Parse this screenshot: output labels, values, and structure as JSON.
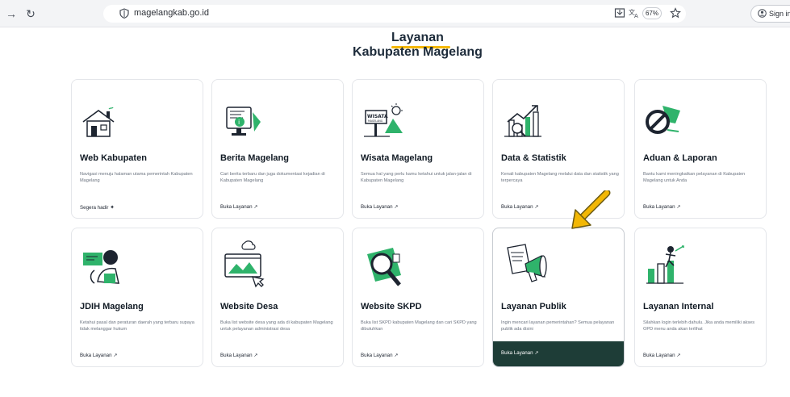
{
  "browser": {
    "url": "magelangkab.go.id",
    "zoom": "67%",
    "sign_in": "Sign in"
  },
  "page": {
    "title_line1": "Layanan",
    "title_line2": "Kabupaten Magelang"
  },
  "cards": [
    {
      "title": "Web Kabupaten",
      "desc": "Navigasi menuju halaman utama pemerintah Kabupaten Magelang",
      "link": "Segera hadir",
      "link_icon": "sparkle-icon"
    },
    {
      "title": "Berita Magelang",
      "desc": "Cari berita terbaru dan juga dokumentasi kejadian di Kabupaten Magelang",
      "link": "Buka Layanan",
      "link_icon": "external-arrow-icon"
    },
    {
      "title": "Wisata Magelang",
      "desc": "Semua hal yang perlu kamu ketahui untuk jalan-jalan di Kabupaten Magelang",
      "link": "Buka Layanan",
      "link_icon": "external-arrow-icon"
    },
    {
      "title": "Data & Statistik",
      "desc": "Kenali kabupaten Magelang melalui data dan statistik yang terpercaya",
      "link": "Buka Layanan",
      "link_icon": "external-arrow-icon"
    },
    {
      "title": "Aduan & Laporan",
      "desc": "Bantu kami meningkatkan pelayanan di Kabupaten Magelang untuk Anda",
      "link": "Buka Layanan",
      "link_icon": "external-arrow-icon"
    },
    {
      "title": "JDIH Magelang",
      "desc": "Ketahui pasal dan peraturan daerah yang terbaru supaya tidak melanggar hukum",
      "link": "Buka Layanan",
      "link_icon": "external-arrow-icon"
    },
    {
      "title": "Website Desa",
      "desc": "Buka list website desa yang ada di kabupaten Magelang untuk pelayanan administrasi desa",
      "link": "Buka Layanan",
      "link_icon": "external-arrow-icon"
    },
    {
      "title": "Website SKPD",
      "desc": "Buka list SKPD kabupaten Magelang dan cari SKPD yang dibutuhkan",
      "link": "Buka Layanan",
      "link_icon": "external-arrow-icon"
    },
    {
      "title": "Layanan Publik",
      "desc": "Ingin mencari layanan pemerintahan? Semua pelayanan publik ada disini",
      "link": "Buka Layanan",
      "link_icon": "external-arrow-icon"
    },
    {
      "title": "Layanan Internal",
      "desc": "Silahkan login terlebih dahulu. Jika anda memiliki akses OPD menu anda akan terlihat",
      "link": "Buka Layanan",
      "link_icon": "external-arrow-icon"
    }
  ],
  "colors": {
    "accent_green": "#2fb36b",
    "footer_dark": "#1e3d37",
    "title_underline": "#f5b800",
    "annotation_arrow": "#f2b705"
  }
}
